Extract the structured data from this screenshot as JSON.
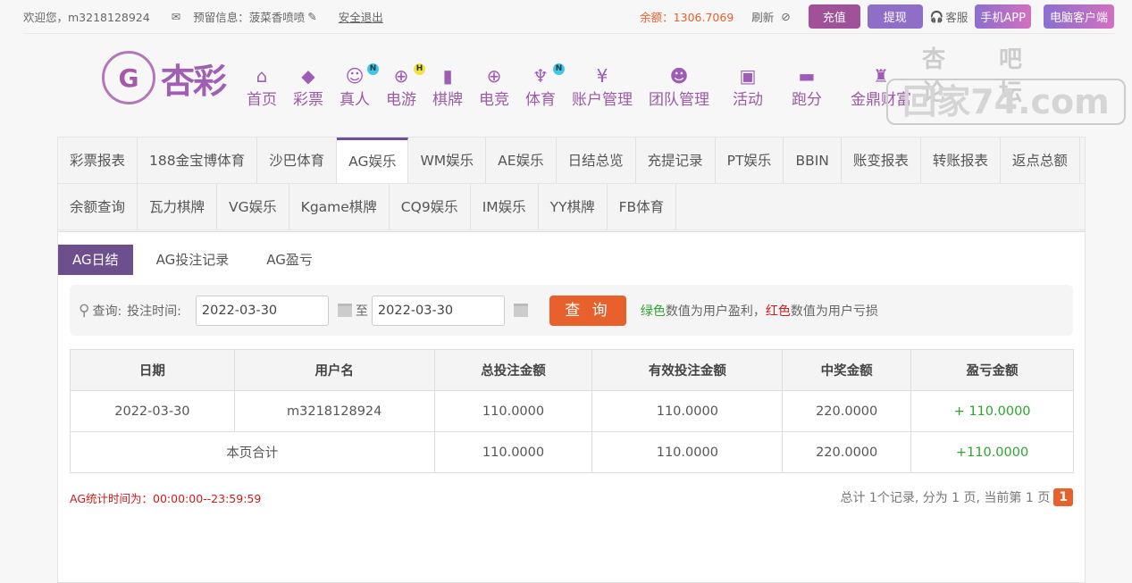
{
  "topbar": {
    "welcome": "欢迎您，m3218128924",
    "reserved": "预留信息：菠菜香喷喷",
    "logout": "安全退出",
    "balance": "余额：1306.7069",
    "refresh": "刷新",
    "recharge": "充值",
    "withdraw": "提现",
    "service": "客服",
    "mobile_app": "手机APP",
    "pc_client": "电脑客户端"
  },
  "logo": {
    "text": "杏彩"
  },
  "nav": [
    {
      "label": "首页",
      "icon": "home-icon"
    },
    {
      "label": "彩票",
      "icon": "ticket-icon"
    },
    {
      "label": "真人",
      "icon": "girl-icon",
      "badge": "N"
    },
    {
      "label": "电游",
      "icon": "gamepad-icon",
      "badge": "H"
    },
    {
      "label": "棋牌",
      "icon": "cards-icon"
    },
    {
      "label": "电竞",
      "icon": "gamepad-icon"
    },
    {
      "label": "体育",
      "icon": "trophy-icon",
      "badge": "N"
    },
    {
      "label": "账户管理",
      "icon": "yen-icon"
    },
    {
      "label": "团队管理",
      "icon": "team-icon"
    },
    {
      "label": "活动",
      "icon": "gift-icon"
    },
    {
      "label": "跑分",
      "icon": "rhino-icon"
    },
    {
      "label": "金鼎财富",
      "icon": "ding-icon"
    }
  ],
  "watermark": {
    "line1": "杏吧  论坛",
    "line2": "回家74.com"
  },
  "tabs_row1": [
    "彩票报表",
    "188金宝博体育",
    "沙巴体育",
    "AG娱乐",
    "WM娱乐",
    "AE娱乐",
    "日结总览",
    "充提记录",
    "PT娱乐",
    "BBIN",
    "账变报表",
    "转账报表",
    "返点总额"
  ],
  "tabs_row2": [
    "余额查询",
    "瓦力棋牌",
    "VG娱乐",
    "Kgame棋牌",
    "CQ9娱乐",
    "IM娱乐",
    "YY棋牌",
    "FB体育"
  ],
  "subtabs": [
    "AG日结",
    "AG投注记录",
    "AG盈亏"
  ],
  "search": {
    "label": "查询:",
    "time_label": "投注时间:",
    "from": "2022-03-30",
    "to_label": "至",
    "to": "2022-03-30",
    "button": "查 询",
    "hint_green": "绿色",
    "hint_mid": "数值为用户盈利，",
    "hint_red": "红色",
    "hint_end": "数值为用户亏损"
  },
  "table": {
    "headers": [
      "日期",
      "用户名",
      "总投注金额",
      "有效投注金额",
      "中奖金额",
      "盈亏金额"
    ],
    "row": [
      "2022-03-30",
      "m3218128924",
      "110.0000",
      "110.0000",
      "220.0000",
      "+ 110.0000"
    ],
    "total": [
      "本页合计",
      "110.0000",
      "110.0000",
      "220.0000",
      "+110.0000"
    ]
  },
  "footer": {
    "note": "AG统计时间为：00:00:00--23:59:59",
    "pager": "总计 1个记录, 分为 1 页, 当前第 1 页",
    "page": "1"
  }
}
